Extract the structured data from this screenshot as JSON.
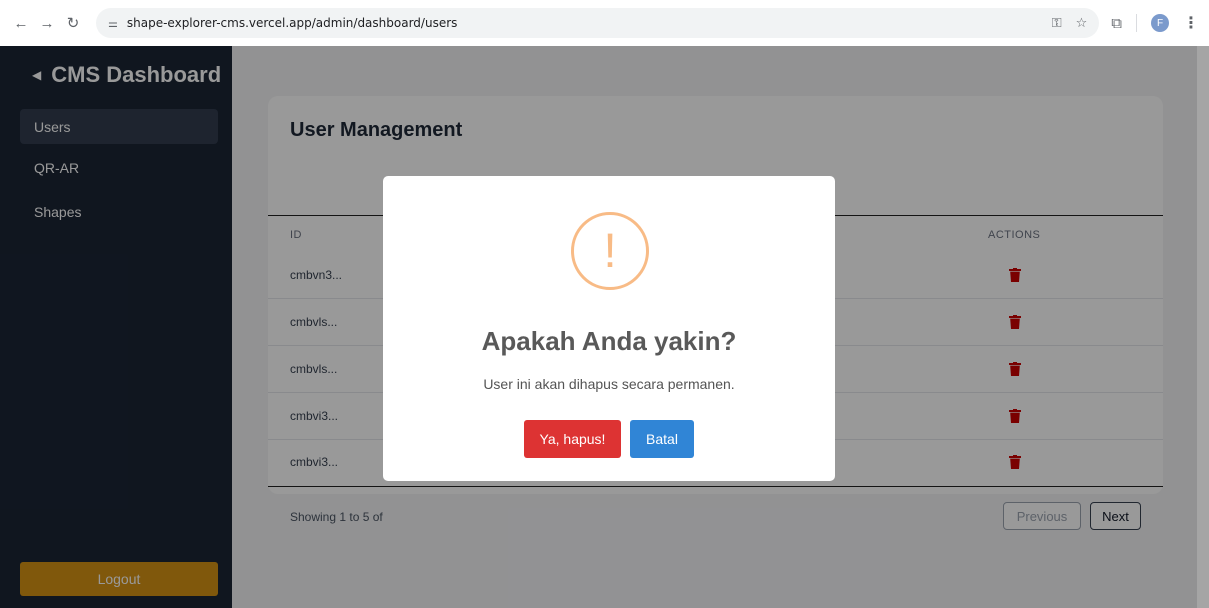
{
  "browser": {
    "url": "shape-explorer-cms.vercel.app/admin/dashboard/users",
    "profile_initial": "F",
    "icons": [
      "back-arrow-icon",
      "forward-arrow-icon",
      "reload-icon",
      "site-info-icon",
      "password-key-icon",
      "bookmark-star-icon",
      "extensions-icon",
      "menu-kebab-icon"
    ]
  },
  "sidebar": {
    "brand": "CMS Dashboard",
    "items": [
      {
        "label": "Users",
        "active": true
      },
      {
        "label": "QR-AR",
        "active": false
      },
      {
        "label": "Shapes",
        "active": false
      }
    ],
    "logout_label": "Logout"
  },
  "card": {
    "title": "User Management",
    "columns": [
      "ID",
      "ACTIONS"
    ],
    "rows": [
      {
        "id": "cmbvn3..."
      },
      {
        "id": "cmbvls..."
      },
      {
        "id": "cmbvls..."
      },
      {
        "id": "cmbvi3..."
      },
      {
        "id": "cmbvi3..."
      }
    ],
    "footer": "Showing 1 to 5 of",
    "previous_label": "Previous",
    "next_label": "Next"
  },
  "modal": {
    "icon_glyph": "!",
    "title": "Apakah Anda yakin?",
    "text": "User ini akan dihapus secara permanen.",
    "confirm_label": "Ya, hapus!",
    "cancel_label": "Batal"
  },
  "colors": {
    "sidebar_bg": "#1b2535",
    "logout": "#d69314",
    "danger": "#dd3333",
    "primary": "#3085d6",
    "warning": "#f8bb86",
    "trash": "#cc0000"
  }
}
